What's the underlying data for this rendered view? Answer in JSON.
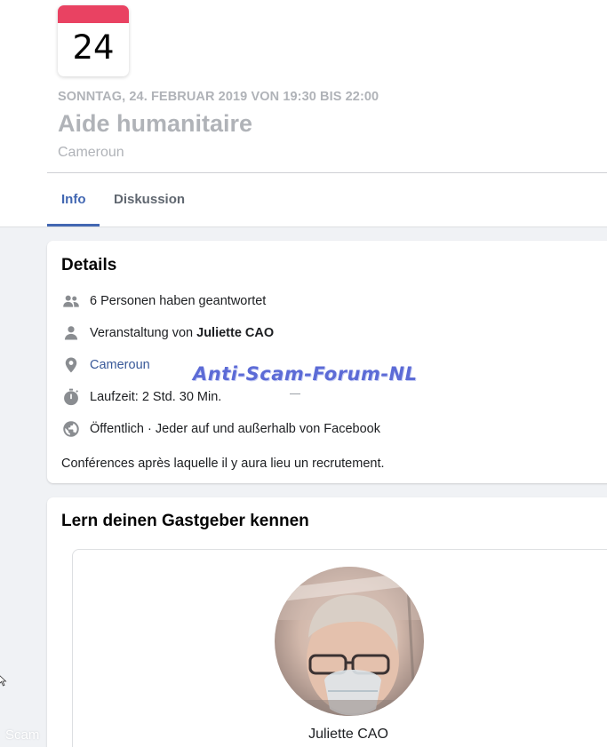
{
  "calendar": {
    "day": "24"
  },
  "event": {
    "date_line": "SONNTAG, 24. FEBRUAR 2019 VON 19:30 BIS 22:00",
    "title": "Aide humanitaire",
    "location": "Cameroun"
  },
  "tabs": [
    {
      "label": "Info",
      "active": true
    },
    {
      "label": "Diskussion",
      "active": false
    }
  ],
  "details": {
    "title": "Details",
    "responses": "6 Personen haben geantwortet",
    "organizer_prefix": "Veranstaltung von ",
    "organizer_name": "Juliette CAO",
    "place": "Cameroun",
    "duration": "Laufzeit: 2 Std. 30 Min.",
    "privacy": "Öffentlich · Jeder auf und außerhalb von Facebook",
    "description": "Conférences après laquelle il y aura lieu un recrutement."
  },
  "host": {
    "title": "Lern deinen Gastgeber kennen",
    "name": "Juliette CAO"
  },
  "watermark": {
    "text": "Anti-Scam-Forum-NL",
    "corner": "Scam"
  },
  "colors": {
    "accent": "#4267b2",
    "calendar_red": "#e94262",
    "link": "#385898",
    "muted": "#b0b3b8"
  },
  "icons": [
    "people-icon",
    "person-icon",
    "location-pin-icon",
    "stopwatch-icon",
    "globe-icon"
  ]
}
